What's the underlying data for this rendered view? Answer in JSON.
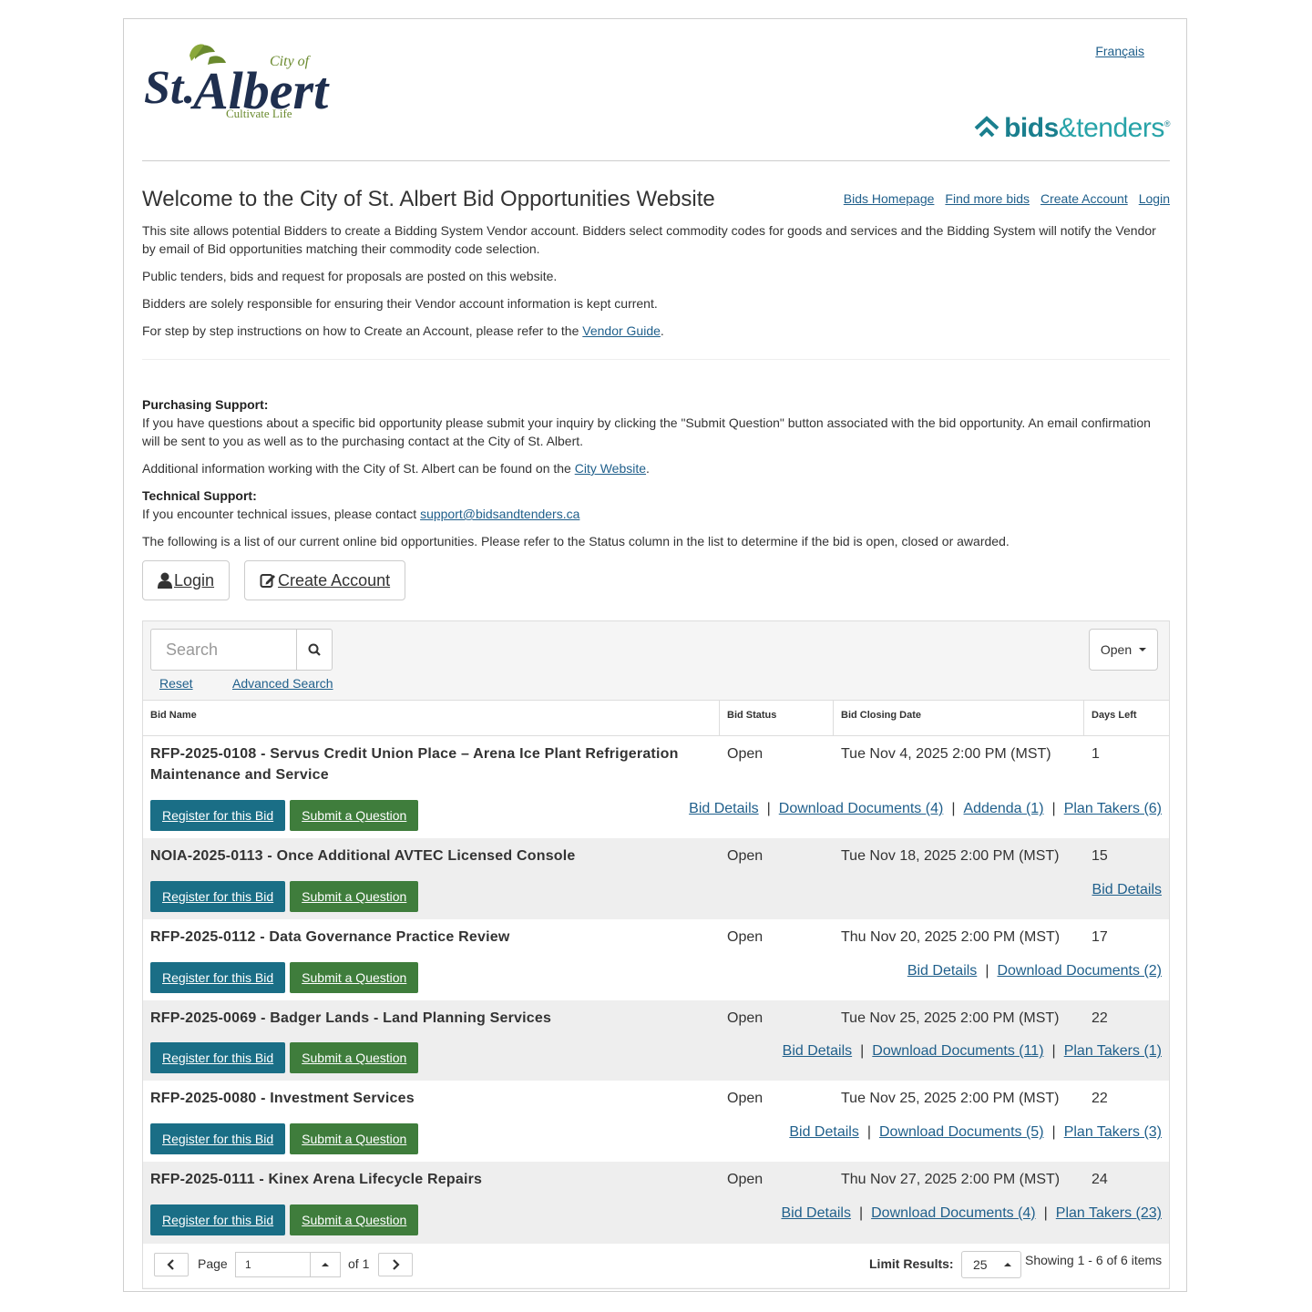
{
  "header": {
    "logo_text_top": "City of",
    "logo_text_main": "St.Albert",
    "logo_text_tag": "Cultivate Life",
    "language_link": "Français",
    "bt_logo_bold": "bids",
    "bt_logo_light": "&tenders",
    "bt_logo_tm": "®"
  },
  "intro": {
    "title": "Welcome to the City of St. Albert Bid Opportunities Website",
    "nav": [
      "Bids Homepage",
      "Find more bids",
      "Create Account",
      "Login"
    ],
    "p1": "This site allows potential Bidders to create a Bidding System Vendor account.  Bidders select commodity codes for goods and services and the Bidding System will notify the Vendor by email of Bid opportunities matching their commodity code selection.",
    "p2": "Public tenders, bids and request for proposals are posted on this website.",
    "p3": "Bidders are solely responsible for ensuring their Vendor account information is kept current.",
    "p4_pre": "For step by step instructions on how to Create an Account, please refer to the ",
    "p4_link": "Vendor Guide",
    "p4_post": ".",
    "purch_heading": "Purchasing Support:",
    "purch_text": "If you have questions about a specific bid opportunity please submit your inquiry by clicking the \"Submit Question\" button associated with the bid opportunity. An email confirmation will be sent to you as well as to the purchasing contact at the City of St. Albert.",
    "add_pre": "Additional information working with the City of St. Albert can be found on the ",
    "add_link": "City Website",
    "add_post": ".",
    "tech_heading": "Technical Support:",
    "tech_pre": "If you encounter technical issues, please contact ",
    "tech_link": "support@bidsandtenders.ca",
    "list_text": "The following is a list of our current online bid opportunities. Please refer to the Status column in the list to determine if the bid is open, closed or awarded."
  },
  "buttons": {
    "login": "Login",
    "create_account": "Create Account"
  },
  "search": {
    "placeholder": "Search",
    "reset": "Reset",
    "advanced": "Advanced Search",
    "status_filter": "Open"
  },
  "table": {
    "headers": [
      "Bid Name",
      "Bid Status",
      "Bid Closing Date",
      "Days Left"
    ],
    "register_label": "Register for this Bid",
    "question_label": "Submit a Question",
    "rows": [
      {
        "name": "RFP-2025-0108 - Servus Credit Union Place – Arena Ice Plant Refrigeration Maintenance and Service",
        "status": "Open",
        "closing": "Tue Nov 4, 2025 2:00 PM (MST)",
        "days": "1",
        "links": [
          "Bid Details",
          "Download Documents (4)",
          "Addenda (1)",
          "Plan Takers (6)"
        ]
      },
      {
        "name": "NOIA-2025-0113 - Once Additional AVTEC Licensed Console",
        "status": "Open",
        "closing": "Tue Nov 18, 2025 2:00 PM (MST)",
        "days": "15",
        "links": [
          "Bid Details"
        ]
      },
      {
        "name": "RFP-2025-0112 - Data Governance Practice Review",
        "status": "Open",
        "closing": "Thu Nov 20, 2025 2:00 PM (MST)",
        "days": "17",
        "links": [
          "Bid Details",
          "Download Documents (2)"
        ]
      },
      {
        "name": "RFP-2025-0069 - Badger Lands - Land Planning Services",
        "status": "Open",
        "closing": "Tue Nov 25, 2025 2:00 PM (MST)",
        "days": "22",
        "links": [
          "Bid Details",
          "Download Documents (11)",
          "Plan Takers (1)"
        ]
      },
      {
        "name": "RFP-2025-0080 - Investment Services",
        "status": "Open",
        "closing": "Tue Nov 25, 2025 2:00 PM (MST)",
        "days": "22",
        "links": [
          "Bid Details",
          "Download Documents (5)",
          "Plan Takers (3)"
        ]
      },
      {
        "name": "RFP-2025-0111 - Kinex Arena Lifecycle Repairs",
        "status": "Open",
        "closing": "Thu Nov 27, 2025 2:00 PM (MST)",
        "days": "24",
        "links": [
          "Bid Details",
          "Download Documents (4)",
          "Plan Takers (23)"
        ]
      }
    ]
  },
  "pager": {
    "page_label": "Page",
    "page_value": "1",
    "of_label": "of 1",
    "limit_label": "Limit Results:",
    "limit_value": "25",
    "showing": "Showing 1 - 6 of 6 items"
  },
  "colors": {
    "link": "#1f5f8b",
    "register_btn": "#1a6e86",
    "question_btn": "#3f7d3c",
    "brand_teal": "#1a7f8e",
    "logo_navy": "#1f2f4f",
    "logo_green": "#6a8a2e"
  },
  "icons": [
    "user-icon",
    "edit-icon",
    "search-icon",
    "caret-down-icon",
    "chevron-left-icon",
    "chevron-right-icon",
    "caret-up-icon",
    "bt-chevron-icon"
  ]
}
